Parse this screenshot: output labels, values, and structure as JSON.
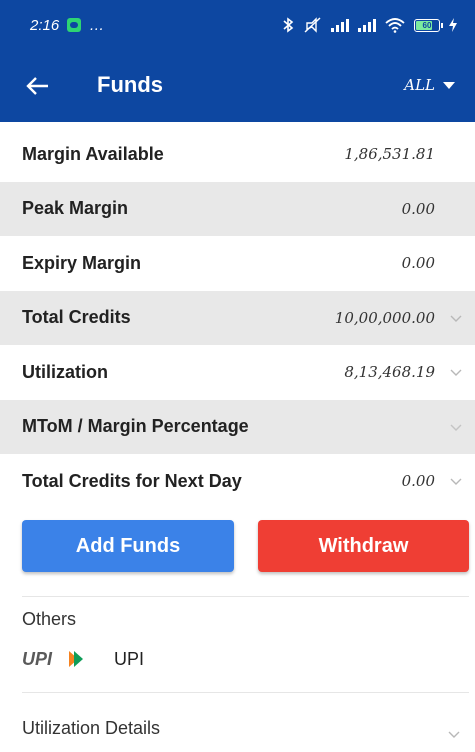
{
  "status_bar": {
    "time": "2:16",
    "more": "…",
    "battery_level": "60"
  },
  "app_bar": {
    "title": "Funds",
    "segment_selected": "ALL"
  },
  "funds": [
    {
      "label": "Margin Available",
      "value": "1,86,531.81",
      "expandable": false
    },
    {
      "label": "Peak Margin",
      "value": "0.00",
      "expandable": false
    },
    {
      "label": "Expiry Margin",
      "value": "0.00",
      "expandable": false
    },
    {
      "label": "Total Credits",
      "value": "10,00,000.00",
      "expandable": true
    },
    {
      "label": "Utilization",
      "value": "8,13,468.19",
      "expandable": true
    },
    {
      "label": "MToM / Margin Percentage",
      "value": "",
      "expandable": true
    },
    {
      "label": "Total Credits for Next Day",
      "value": "0.00",
      "expandable": true
    }
  ],
  "actions": {
    "add_funds": "Add Funds",
    "withdraw": "Withdraw"
  },
  "others": {
    "heading": "Others",
    "upi_logo_text": "UPI",
    "upi_label": "UPI"
  },
  "utilization_details": {
    "label": "Utilization Details"
  },
  "colors": {
    "app_bar": "#0d47a1",
    "add_funds": "#3b82e8",
    "withdraw": "#ef3e34",
    "alt_row": "#e8e8e8"
  }
}
